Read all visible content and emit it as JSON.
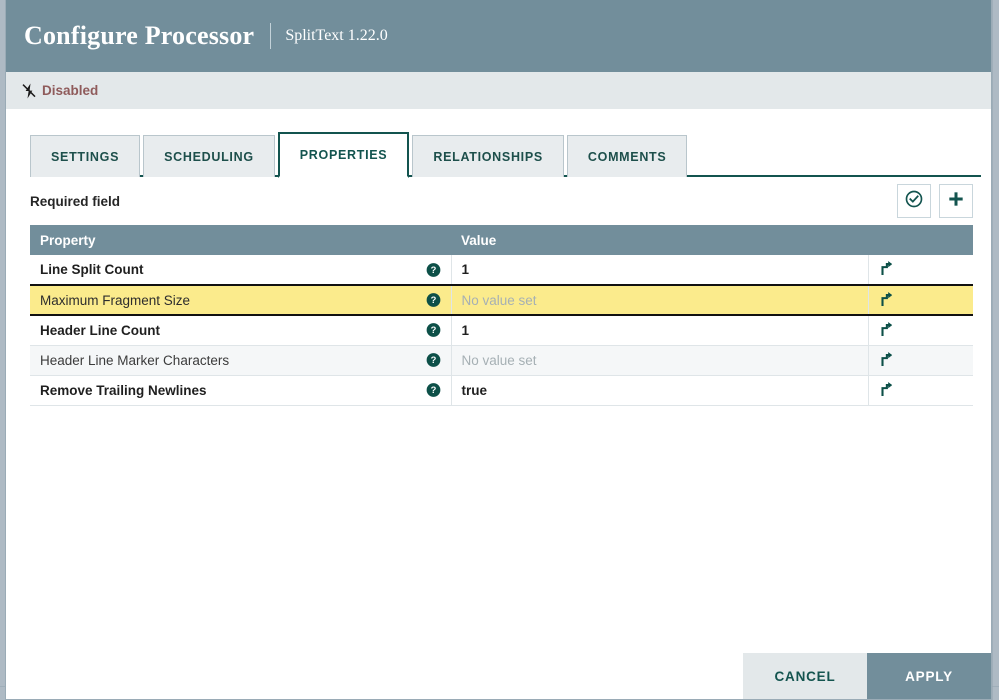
{
  "header": {
    "title": "Configure Processor",
    "subtitle": "SplitText 1.22.0"
  },
  "status": {
    "icon": "flash-off-icon",
    "label": "Disabled",
    "color": "#8f5b5b"
  },
  "tabs": [
    {
      "label": "SETTINGS",
      "active": false
    },
    {
      "label": "SCHEDULING",
      "active": false
    },
    {
      "label": "PROPERTIES",
      "active": true
    },
    {
      "label": "RELATIONSHIPS",
      "active": false
    },
    {
      "label": "COMMENTS",
      "active": false
    }
  ],
  "toolbar": {
    "required_label": "Required field",
    "verify_icon": "check-circle-icon",
    "add_icon": "plus-icon"
  },
  "table": {
    "columns": [
      "Property",
      "Value",
      ""
    ],
    "help_icon": "help-circle-icon",
    "goto_icon": "arrow-up-right-icon",
    "empty_value_text": "No value set",
    "rows": [
      {
        "property": "Line Split Count",
        "value": "1",
        "required": true,
        "empty": false,
        "selected": false,
        "alt": false
      },
      {
        "property": "Maximum Fragment Size",
        "value": "No value set",
        "required": false,
        "empty": true,
        "selected": true,
        "alt": false
      },
      {
        "property": "Header Line Count",
        "value": "1",
        "required": true,
        "empty": false,
        "selected": false,
        "alt": false
      },
      {
        "property": "Header Line Marker Characters",
        "value": "No value set",
        "required": false,
        "empty": true,
        "selected": false,
        "alt": true
      },
      {
        "property": "Remove Trailing Newlines",
        "value": "true",
        "required": true,
        "empty": false,
        "selected": false,
        "alt": false
      }
    ]
  },
  "footer": {
    "cancel_label": "CANCEL",
    "apply_label": "APPLY"
  },
  "colors": {
    "header_bg": "#728e9b",
    "accent": "#13544f",
    "highlight_row": "#fbeb8c",
    "status_text": "#8f5b5b"
  }
}
